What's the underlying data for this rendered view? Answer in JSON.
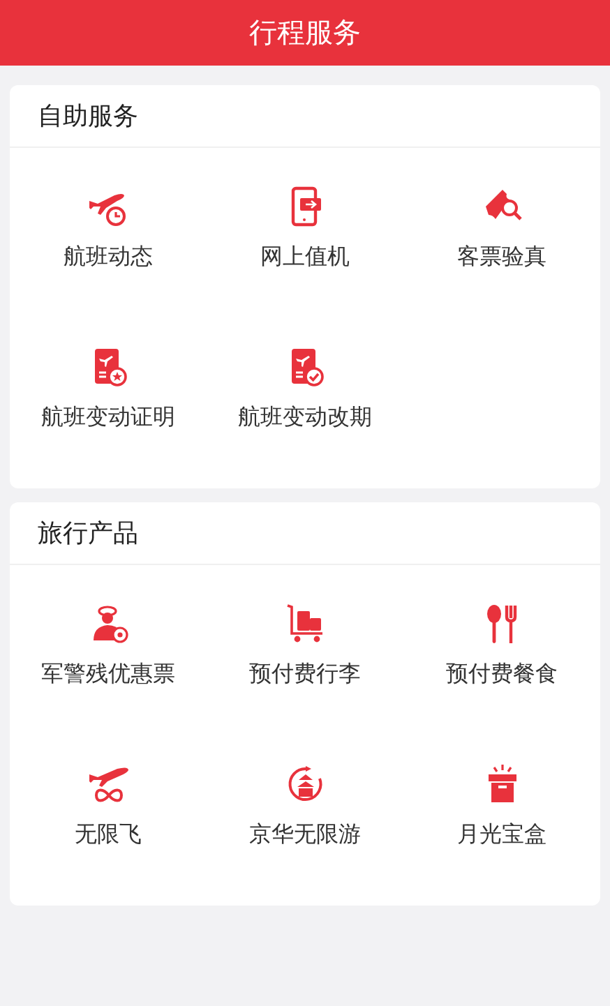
{
  "header": {
    "title": "行程服务"
  },
  "sections": [
    {
      "title": "自助服务",
      "items": [
        {
          "label": "航班动态",
          "kind": "plane-clock"
        },
        {
          "label": "网上值机",
          "kind": "phone-ticket"
        },
        {
          "label": "客票验真",
          "kind": "ticket-search"
        },
        {
          "label": "航班变动证明",
          "kind": "doc-star"
        },
        {
          "label": "航班变动改期",
          "kind": "doc-check"
        }
      ]
    },
    {
      "title": "旅行产品",
      "items": [
        {
          "label": "军警残优惠票",
          "kind": "officer"
        },
        {
          "label": "预付费行李",
          "kind": "cart"
        },
        {
          "label": "预付费餐食",
          "kind": "cutlery"
        },
        {
          "label": "无限飞",
          "kind": "plane-infinity"
        },
        {
          "label": "京华无限游",
          "kind": "temple"
        },
        {
          "label": "月光宝盒",
          "kind": "box"
        }
      ]
    }
  ]
}
